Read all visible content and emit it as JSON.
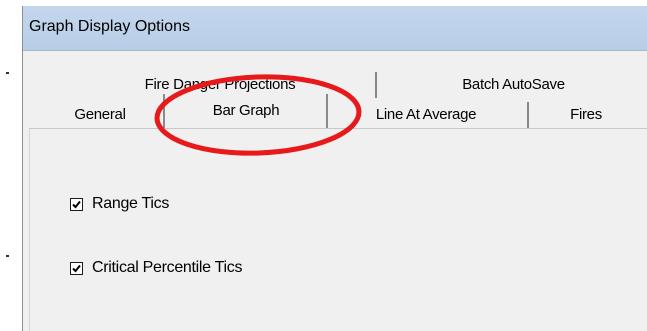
{
  "window": {
    "title": "Graph Display Options"
  },
  "tabs_back_row": [
    {
      "label": "Fire Danger Projections"
    },
    {
      "label": "Batch AutoSave"
    }
  ],
  "tabs_front_row": [
    {
      "label": "General"
    },
    {
      "label": "Bar Graph",
      "selected": true
    },
    {
      "label": "Line At Average"
    },
    {
      "label": "Fires"
    }
  ],
  "options": {
    "range_tics": {
      "label": "Range Tics",
      "checked": true
    },
    "critical_percentile_tics": {
      "label": "Critical Percentile Tics",
      "checked": true
    }
  },
  "annotation": {
    "highlight_color": "#e8191a"
  },
  "colors": {
    "titlebar": "#bfd3eb",
    "dialog_bg": "#f0f0f0"
  }
}
